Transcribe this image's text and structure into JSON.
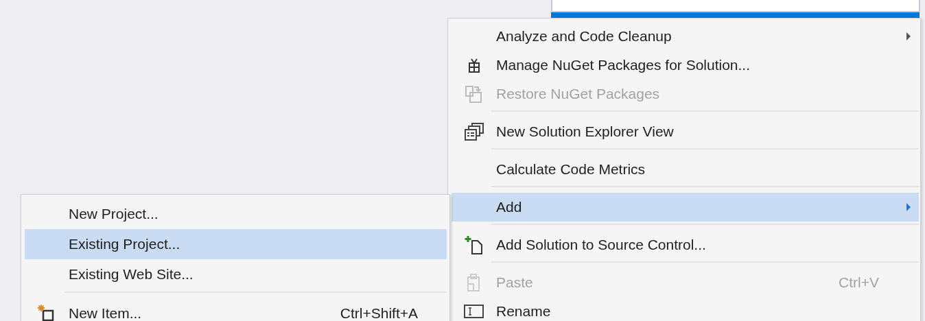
{
  "context_menu": {
    "items": [
      {
        "kind": "item",
        "label": "Analyze and Code Cleanup",
        "submenu": true,
        "disabled": false,
        "selected": false
      },
      {
        "kind": "item",
        "label": "Manage NuGet Packages for Solution...",
        "disabled": false,
        "selected": false
      },
      {
        "kind": "item",
        "label": "Restore NuGet Packages",
        "disabled": true,
        "selected": false
      },
      {
        "kind": "separator"
      },
      {
        "kind": "item",
        "label": "New Solution Explorer View",
        "disabled": false,
        "selected": false
      },
      {
        "kind": "separator"
      },
      {
        "kind": "item",
        "label": "Calculate Code Metrics",
        "disabled": false,
        "selected": false
      },
      {
        "kind": "separator"
      },
      {
        "kind": "item",
        "label": "Add",
        "submenu": true,
        "disabled": false,
        "selected": true
      },
      {
        "kind": "separator"
      },
      {
        "kind": "item",
        "label": "Add Solution to Source Control...",
        "disabled": false,
        "selected": false
      },
      {
        "kind": "separator"
      },
      {
        "kind": "item",
        "label": "Paste",
        "shortcut": "Ctrl+V",
        "disabled": true,
        "selected": false
      },
      {
        "kind": "item",
        "label": "Rename",
        "disabled": false,
        "selected": false
      }
    ]
  },
  "add_submenu": {
    "items": [
      {
        "kind": "item",
        "label": "New Project...",
        "disabled": false,
        "selected": false
      },
      {
        "kind": "item",
        "label": "Existing Project...",
        "disabled": false,
        "selected": true
      },
      {
        "kind": "item",
        "label": "Existing Web Site...",
        "disabled": false,
        "selected": false
      },
      {
        "kind": "separator"
      },
      {
        "kind": "item",
        "label": "New Item...",
        "shortcut": "Ctrl+Shift+A",
        "disabled": false,
        "selected": false
      }
    ]
  }
}
